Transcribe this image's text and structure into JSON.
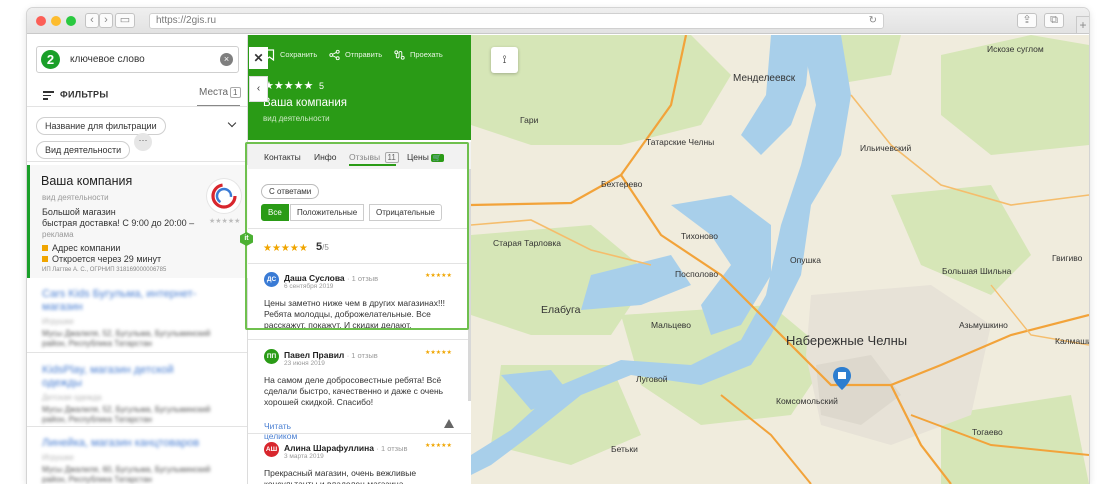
{
  "browser": {
    "url": "https://2gis.ru"
  },
  "left_panel": {
    "search_value": "ключевое слово",
    "filters_label": "ФИЛЬТРЫ",
    "places_label": "Места",
    "places_count": "1",
    "chips": [
      "Название для фильтрации",
      "Вид деятельности"
    ],
    "more_chip": "···",
    "selected_card": {
      "title": "Ваша компания",
      "subtitle": "вид деятельности",
      "desc1": "Большой магазин",
      "desc2": "быстрая доставка! С 9:00 до 20:00 –",
      "ad": "реклама",
      "address": "Адрес компании",
      "hours": "Откроется через 29 минут",
      "legal": "ИП Латтве А. С., ОГРНИП 318169000006785",
      "stars": "★★★★★"
    },
    "blurred_items": [
      {
        "title": "Cars Kids Бугульма, интернет-магазин",
        "type": "Игрушки",
        "address": "Мусы Джалиля, 52, Бугульма, Бугульминский район, Республика Татарстан"
      },
      {
        "title": "KidsPlay, магазин детской одежды",
        "type": "Детская одежда",
        "address": "Мусы Джалиля, 52, Бугульма, Бугульминский район, Республика Татарстан"
      },
      {
        "title": "Линейка, магазин канцтоваров",
        "type": "Игрушки",
        "address": "Мусы Джалиля, 60, Бугульма, Бугульминский район, Республика Татарстан"
      }
    ]
  },
  "company_panel": {
    "actions": [
      "Сохранить",
      "Отправить",
      "Проехать"
    ],
    "stars": "★★★★★",
    "rating": "5",
    "name": "Ваша компания",
    "subtitle": "вид деятельности",
    "tabs": [
      "Контакты",
      "Инфо",
      "Отзывы",
      "Цены"
    ],
    "reviews_count": "11",
    "with_answers": "С ответами",
    "segments": [
      "Все",
      "Положительные",
      "Отрицательные"
    ],
    "total_rating": "5",
    "total_rating_of": "/5",
    "it_badge": "it",
    "reviews": [
      {
        "initials": "ДС",
        "name": "Даша Суслова",
        "count": "· 1 отзыв",
        "date": "6 сентября 2019",
        "stars": "★★★★★",
        "color": "#3a7bd5",
        "text": "Цены заметно ниже чем в других магазинах!!! Ребята молодцы, доброжелательные. Все расскажут, покажут. И скидки делают."
      },
      {
        "initials": "ПП",
        "name": "Павел Правил",
        "count": "· 1 отзыв",
        "date": "23 июня 2019",
        "stars": "★★★★★",
        "color": "#2a9b16",
        "text": "На самом деле добросовестные ребята! Всё сделали быстро, качественно и даже с очень хорошей скидкой. Спасибо!",
        "link": "Читать целиком"
      },
      {
        "initials": "АШ",
        "name": "Алина Шарафуллина",
        "count": "· 1 отзыв",
        "date": "3 марта 2019",
        "stars": "★★★★★",
        "color": "#d8262d",
        "text": "Прекрасный магазин, очень вежливые консультанты и владелец магазина."
      }
    ]
  },
  "map": {
    "city_big": "Набережные Челны",
    "labels": [
      "Искозе суглом",
      "Менделеевск",
      "Гари",
      "Татарские Челны",
      "Ильичевский",
      "Бехтерево",
      "Старая Тарловка",
      "Тихоново",
      "Опушка",
      "Большая Шильна",
      "Гвигиво",
      "Посполово",
      "Елабуга",
      "Мальцево",
      "Азьмушкино",
      "Луговой",
      "Калмаши",
      "Комсомольский",
      "Тогаево",
      "Бетьки"
    ]
  },
  "colors": {
    "brand": "#2a9b16",
    "water": "#a8cfea",
    "land": "#f0ecdd",
    "road": "#f2a33a"
  }
}
